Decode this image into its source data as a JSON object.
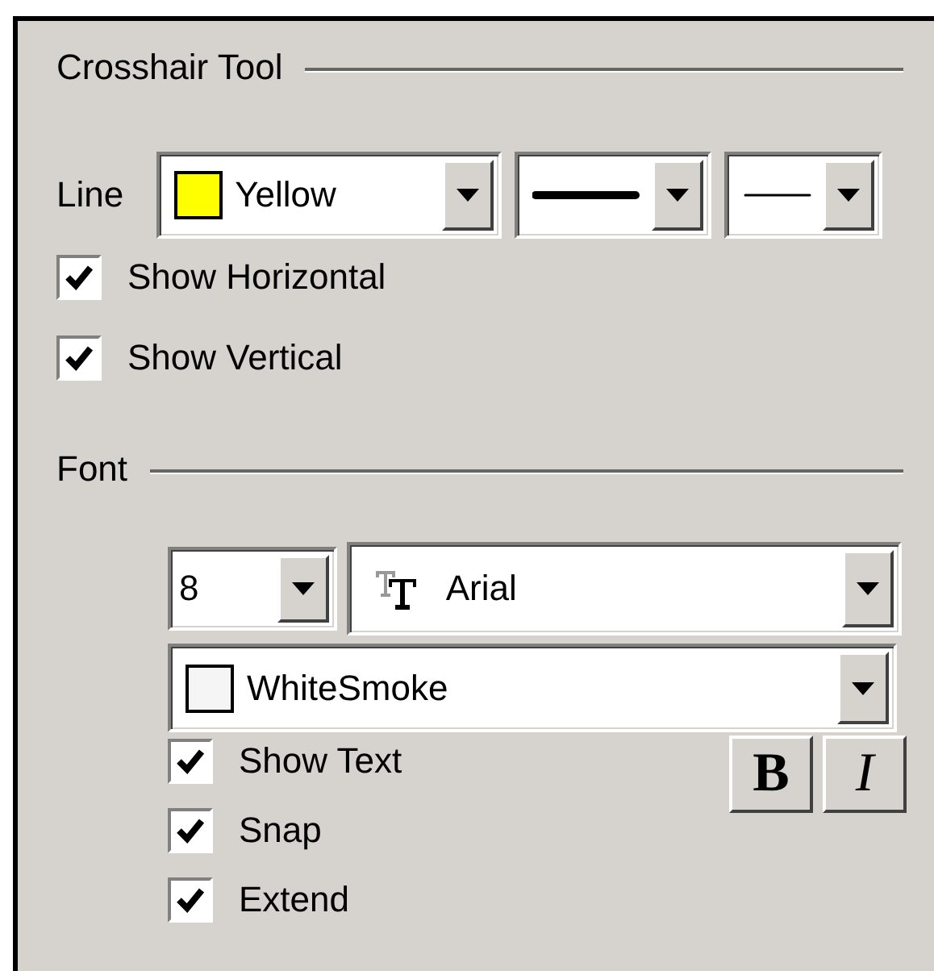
{
  "crosshair": {
    "title": "Crosshair Tool",
    "line": {
      "label": "Line",
      "color": {
        "name": "Yellow",
        "color": "#ffff00"
      },
      "styles": [
        {
          "kind": "thick"
        },
        {
          "kind": "thin"
        }
      ]
    },
    "options": [
      {
        "label": "Show Horizontal",
        "checked": true
      },
      {
        "label": "Show Vertical",
        "checked": true
      }
    ]
  },
  "font": {
    "title": "Font",
    "size": "8",
    "family": "Arial",
    "color": {
      "name": "WhiteSmoke",
      "color": "#f5f5f5"
    },
    "options": [
      {
        "label": "Show Text",
        "checked": true
      },
      {
        "label": "Snap",
        "checked": true
      },
      {
        "label": "Extend",
        "checked": true
      }
    ],
    "buttons": [
      {
        "kind": "bold",
        "label": "B"
      },
      {
        "kind": "italic",
        "label": "I"
      }
    ]
  }
}
